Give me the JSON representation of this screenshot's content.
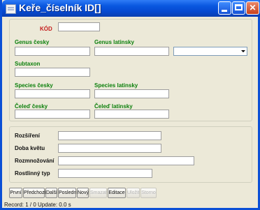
{
  "window": {
    "title": "Keře_číselník ID[]",
    "minimize_icon": "minimize-icon",
    "maximize_icon": "maximize-icon",
    "close_icon": "close-icon"
  },
  "section1": {
    "kod_label": "KÓD",
    "genus_cesky_label": "Genus česky",
    "genus_latinsky_label": "Genus latinsky",
    "subtaxon_label": "Subtaxon",
    "species_cesky_label": "Species česky",
    "species_latinsky_label": "Species latinsky",
    "celed_cesky_label": "Čeleď česky",
    "celed_latinsky_label": "Čeleď latinsky"
  },
  "section2": {
    "rozsireni_label": "Rozšíření",
    "doba_kvetu_label": "Doba květu",
    "rozmnozovani_label": "Rozmnožování",
    "rostlinny_typ_label": "Rostlinný typ"
  },
  "buttons": {
    "first": "První",
    "previous": "Předchozí",
    "next": "Další",
    "last": "Poslední",
    "new": "Nový",
    "delete": "Smazat",
    "edit": "Editace",
    "save": "Uložit",
    "cancel": "Storno"
  },
  "status": {
    "text": "Record: 1 / 0  Update: 0.0 s"
  },
  "colors": {
    "label_green": "#0b7f0b",
    "label_red": "#c51e1e",
    "titlebar": "#0a58e0"
  }
}
